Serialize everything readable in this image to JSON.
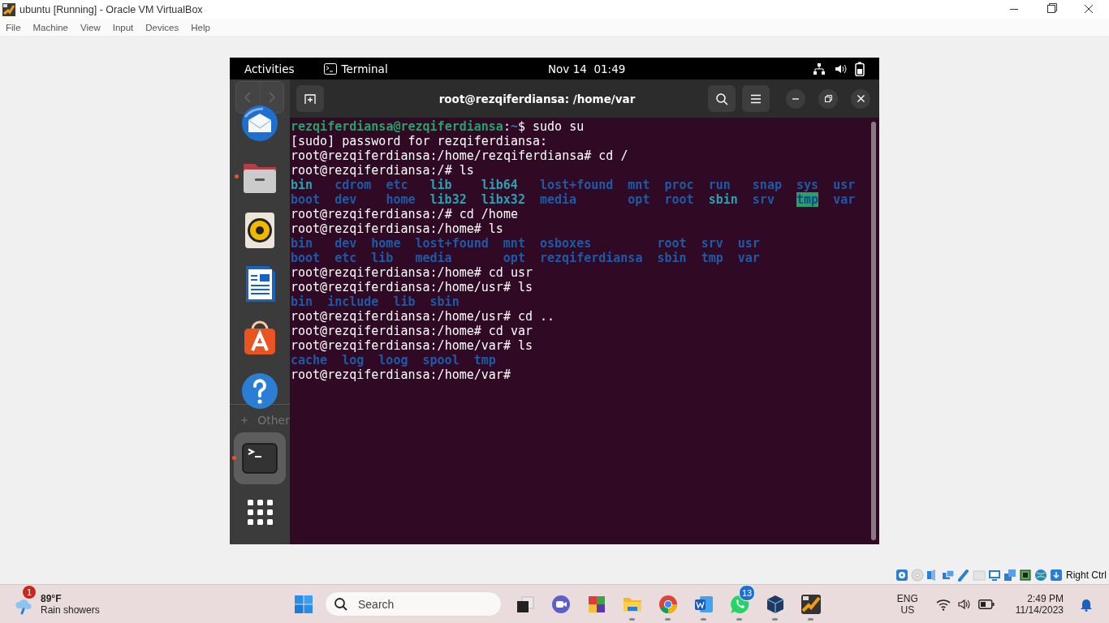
{
  "window": {
    "title": "ubuntu [Running] - Oracle VM VirtualBox"
  },
  "menu": [
    "File",
    "Machine",
    "View",
    "Input",
    "Devices",
    "Help"
  ],
  "guest": {
    "top_bar": {
      "activities": "Activities",
      "app": "Terminal",
      "clock": "Nov 14  01:49"
    },
    "ghost_other": "Other",
    "dock": [
      {
        "kind": "mail",
        "running": false,
        "selected": false
      },
      {
        "kind": "files",
        "running": true,
        "selected": false
      },
      {
        "kind": "music",
        "running": false,
        "selected": false
      },
      {
        "kind": "writer",
        "running": false,
        "selected": false
      },
      {
        "kind": "store",
        "running": false,
        "selected": false
      },
      {
        "kind": "help",
        "running": false,
        "selected": false
      },
      {
        "kind": "terminal",
        "running": true,
        "selected": true
      },
      {
        "kind": "apps",
        "running": false,
        "selected": false
      }
    ],
    "terminal": {
      "title": "root@rezqiferdiansa: /home/var",
      "lines": [
        {
          "kind": "user_prompt",
          "user": "rezqiferdiansa@rezqiferdiansa",
          "sep": ":",
          "path": "~",
          "command": "$ sudo su"
        },
        {
          "kind": "text",
          "text": "[sudo] password for rezqiferdiansa:"
        },
        {
          "kind": "text",
          "text": "root@rezqiferdiansa:/home/rezqiferdiansa# cd /"
        },
        {
          "kind": "text",
          "text": "root@rezqiferdiansa:/# ls"
        },
        {
          "kind": "listing",
          "rows": [
            [
              {
                "name": "bin",
                "kind": "link"
              },
              {
                "name": "cdrom",
                "kind": "dir"
              },
              {
                "name": "etc",
                "kind": "dir"
              },
              {
                "name": "lib",
                "kind": "link"
              },
              {
                "name": "lib64",
                "kind": "link"
              },
              {
                "name": "lost+found",
                "kind": "dir"
              },
              {
                "name": "mnt",
                "kind": "dir"
              },
              {
                "name": "proc",
                "kind": "dir"
              },
              {
                "name": "run",
                "kind": "dir"
              },
              {
                "name": "snap",
                "kind": "dir"
              },
              {
                "name": "sys",
                "kind": "dir"
              },
              {
                "name": "usr",
                "kind": "dir"
              }
            ],
            [
              {
                "name": "boot",
                "kind": "dir"
              },
              {
                "name": "dev",
                "kind": "dir"
              },
              {
                "name": "home",
                "kind": "dir"
              },
              {
                "name": "lib32",
                "kind": "link"
              },
              {
                "name": "libx32",
                "kind": "link"
              },
              {
                "name": "media",
                "kind": "dir"
              },
              {
                "name": "opt",
                "kind": "dir"
              },
              {
                "name": "root",
                "kind": "dir"
              },
              {
                "name": "sbin",
                "kind": "link"
              },
              {
                "name": "srv",
                "kind": "dir"
              },
              {
                "name": "tmp",
                "kind": "sticky"
              },
              {
                "name": "var",
                "kind": "dir"
              }
            ]
          ]
        },
        {
          "kind": "text",
          "text": "root@rezqiferdiansa:/# cd /home"
        },
        {
          "kind": "text",
          "text": "root@rezqiferdiansa:/home# ls"
        },
        {
          "kind": "listing",
          "rows": [
            [
              {
                "name": "bin",
                "kind": "dir"
              },
              {
                "name": "dev",
                "kind": "dir"
              },
              {
                "name": "home",
                "kind": "dir"
              },
              {
                "name": "lost+found",
                "kind": "dir"
              },
              {
                "name": "mnt",
                "kind": "dir"
              },
              {
                "name": "osboxes",
                "kind": "dir"
              },
              {
                "name": "root",
                "kind": "dir"
              },
              {
                "name": "srv",
                "kind": "dir"
              },
              {
                "name": "usr",
                "kind": "dir"
              }
            ],
            [
              {
                "name": "boot",
                "kind": "dir"
              },
              {
                "name": "etc",
                "kind": "dir"
              },
              {
                "name": "lib",
                "kind": "dir"
              },
              {
                "name": "media",
                "kind": "dir"
              },
              {
                "name": "opt",
                "kind": "dir"
              },
              {
                "name": "rezqiferdiansa",
                "kind": "dir"
              },
              {
                "name": "sbin",
                "kind": "dir"
              },
              {
                "name": "tmp",
                "kind": "dir"
              },
              {
                "name": "var",
                "kind": "dir"
              }
            ]
          ]
        },
        {
          "kind": "text",
          "text": "root@rezqiferdiansa:/home# cd usr"
        },
        {
          "kind": "text",
          "text": "root@rezqiferdiansa:/home/usr# ls"
        },
        {
          "kind": "listing",
          "rows": [
            [
              {
                "name": "bin",
                "kind": "dir"
              },
              {
                "name": "include",
                "kind": "dir"
              },
              {
                "name": "lib",
                "kind": "dir"
              },
              {
                "name": "sbin",
                "kind": "dir"
              }
            ]
          ]
        },
        {
          "kind": "text",
          "text": "root@rezqiferdiansa:/home/usr# cd .."
        },
        {
          "kind": "text",
          "text": "root@rezqiferdiansa:/home# cd var"
        },
        {
          "kind": "text",
          "text": "root@rezqiferdiansa:/home/var# ls"
        },
        {
          "kind": "listing",
          "rows": [
            [
              {
                "name": "cache",
                "kind": "dir"
              },
              {
                "name": "log",
                "kind": "dir"
              },
              {
                "name": "loog",
                "kind": "dir"
              },
              {
                "name": "spool",
                "kind": "dir"
              },
              {
                "name": "tmp",
                "kind": "dir"
              }
            ]
          ]
        },
        {
          "kind": "text",
          "text": "root@rezqiferdiansa:/home/var#"
        }
      ]
    }
  },
  "vbox_status": {
    "host_key": "Right Ctrl"
  },
  "taskbar": {
    "weather": {
      "badge": "1",
      "temperature": "89°F",
      "condition": "Rain showers"
    },
    "search": {
      "placeholder": "Search"
    },
    "apps": [
      {
        "kind": "taskview",
        "running": false
      },
      {
        "kind": "meet",
        "running": false
      },
      {
        "kind": "archive",
        "running": false
      },
      {
        "kind": "folder",
        "running": true
      },
      {
        "kind": "browser",
        "running": true
      },
      {
        "kind": "word",
        "running": true
      },
      {
        "kind": "chat",
        "running": true,
        "badge": "13"
      },
      {
        "kind": "cube",
        "running": true
      },
      {
        "kind": "vm",
        "running": true
      }
    ],
    "language": "ENG",
    "region": "US",
    "time": "2:49 PM",
    "date": "11/14/2023"
  }
}
